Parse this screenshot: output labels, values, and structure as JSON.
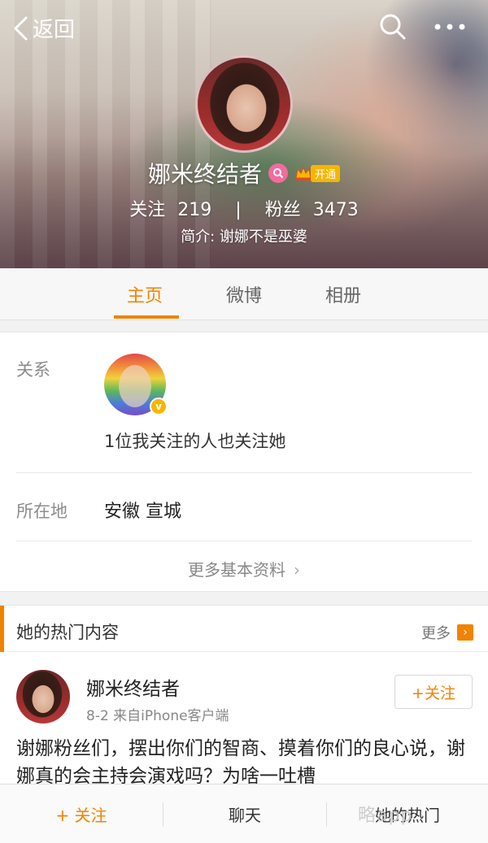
{
  "header": {
    "back_label": "返回",
    "profile_name": "娜米终结者",
    "vip_label": "开通",
    "following_label": "关注",
    "following_count": "219",
    "separator": "|",
    "followers_label": "粉丝",
    "followers_count": "3473",
    "bio": "简介: 谢娜不是巫婆"
  },
  "tabs": [
    {
      "label": "主页",
      "active": true
    },
    {
      "label": "微博",
      "active": false
    },
    {
      "label": "相册",
      "active": false
    }
  ],
  "info": {
    "relation_label": "关系",
    "relation_text": "1位我关注的人也关注她",
    "relation_badge": "v",
    "location_label": "所在地",
    "location_value": "安徽 宣城",
    "more_info_label": "更多基本资料",
    "more_info_chevron": "›"
  },
  "hot": {
    "title": "她的热门内容",
    "more_label": "更多",
    "more_arrow": "›"
  },
  "post": {
    "author": "娜米终结者",
    "meta": "8-2  来自iPhone客户端",
    "follow_label": "+关注",
    "text": "谢娜粉丝们，摆出你们的智商、摸着你们的良心说，谢娜真的会主持会演戏吗？为啥一吐槽"
  },
  "bottom_bar": {
    "follow_label": "+ 关注",
    "chat_label": "聊天",
    "hot_label": "她的热门"
  },
  "watermark": "略app",
  "colors": {
    "accent": "#f08300",
    "vip": "#f7b500",
    "badge_pink": "#f36b9e"
  }
}
